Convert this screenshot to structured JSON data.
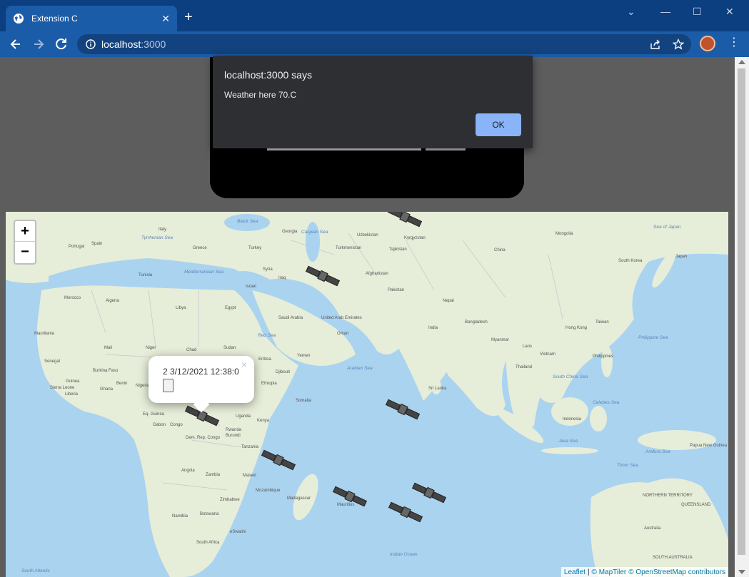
{
  "browser": {
    "tab_title": "Extension C",
    "new_tab_label": "+",
    "url_host": "localhost",
    "url_port": ":3000"
  },
  "dialog": {
    "title": "localhost:3000 says",
    "message": "Weather here 70.C",
    "ok_label": "OK"
  },
  "map": {
    "zoom_in_label": "+",
    "zoom_out_label": "−",
    "popup_text": "2 3/12/2021 12:38:0",
    "popup_close": "×",
    "attribution": {
      "leaflet": "Leaflet",
      "separator": "|",
      "maptiler": "© MapTiler",
      "osm": "© OpenStreetMap contributors"
    },
    "labels": {
      "black_sea": "Black Sea",
      "caspian_sea": "Caspian Sea",
      "tyrrhenian_sea": "Tyrrhenian Sea",
      "mediterranean_sea": "Mediterranean Sea",
      "red_sea": "Red Sea",
      "arabian_sea": "Arabian Sea",
      "indian_ocean": "Indian Ocean",
      "south_china_sea": "South China Sea",
      "philippine_sea": "Philippine Sea",
      "sea_of_japan": "Sea of Japan",
      "celebes_sea": "Celebes Sea",
      "java_sea": "Java Sea",
      "arafura_sea": "Arafura Sea",
      "timor_sea": "Timor Sea",
      "south_atlantic": "South Atlantic",
      "portugal": "Portugal",
      "spain": "Spain",
      "italy": "Italy",
      "turkey": "Turkey",
      "greece": "Greece",
      "georgia": "Georgia",
      "uzbekistan": "Uzbekistan",
      "kyrgyzstan": "Kyrgyzstan",
      "turkmenistan": "Turkmenistan",
      "tajikistan": "Tajikistan",
      "china": "China",
      "mongolia": "Mongolia",
      "south_korea": "South Korea",
      "japan": "Japan",
      "tunisia": "Tunisia",
      "syria": "Syria",
      "iraq": "Iraq",
      "iran": "Iran",
      "afghanistan": "Afghanistan",
      "pakistan": "Pakistan",
      "morocco": "Morocco",
      "algeria": "Algeria",
      "libya": "Libya",
      "egypt": "Egypt",
      "israel": "Israel",
      "saudi_arabia": "Saudi Arabia",
      "uae": "United Arab Emirates",
      "oman": "Oman",
      "yemen": "Yemen",
      "nepal": "Nepal",
      "india": "India",
      "bangladesh": "Bangladesh",
      "myanmar": "Myanmar",
      "laos": "Laos",
      "thailand": "Thailand",
      "vietnam": "Vietnam",
      "philippines": "Philippines",
      "taiwan": "Taiwan",
      "hong_kong": "Hong Kong",
      "sri_lanka": "Sri Lanka",
      "indonesia": "Indonesia",
      "papua_new_guinea": "Papua New Guinea",
      "australia": "Australia",
      "northern_territory": "NORTHERN TERRITORY",
      "queensland": "QUEENSLAND",
      "south_australia": "SOUTH AUSTRALIA",
      "mauritania": "Mauritania",
      "mali": "Mali",
      "niger": "Niger",
      "chad": "Chad",
      "sudan": "Sudan",
      "eritrea": "Eritrea",
      "djibouti": "Djibouti",
      "ethiopia": "Ethiopia",
      "somalia": "Somalia",
      "senegal": "Senegal",
      "guinea": "Guinea",
      "sierra_leone": "Sierra Leone",
      "liberia": "Liberia",
      "burkina_faso": "Burkina Faso",
      "ghana": "Ghana",
      "benin": "Benin",
      "nigeria": "Nigeria",
      "eq_guinea": "Eq. Guinea",
      "gabon": "Gabon",
      "congo": "Congo",
      "dem_rep_congo": "Dem. Rep. Congo",
      "uganda": "Uganda",
      "kenya": "Kenya",
      "rwanda": "Rwanda",
      "burundi": "Burundi",
      "tanzania": "Tanzania",
      "angola": "Angola",
      "zambia": "Zambia",
      "malawi": "Malawi",
      "mozambique": "Mozambique",
      "zimbabwe": "Zimbabwe",
      "madagascar": "Madagascar",
      "mauritius": "Mauritius",
      "namibia": "Namibia",
      "botswana": "Botswana",
      "south_africa": "South Africa",
      "eswatini": "eSwatini"
    }
  },
  "colors": {
    "titlebar": "#0b3f7f",
    "toolbar": "#1b5ca8",
    "dialog_bg": "#2d2f33",
    "ok_button": "#8ab4f8",
    "water": "#aad3f0",
    "land": "#e6edd8"
  },
  "icons": {
    "back": "arrow-left-icon",
    "forward": "arrow-right-icon",
    "reload": "reload-icon",
    "info": "info-icon",
    "share": "share-icon",
    "star": "star-icon",
    "menu": "kebab-menu-icon",
    "satellite": "satellite-icon"
  }
}
